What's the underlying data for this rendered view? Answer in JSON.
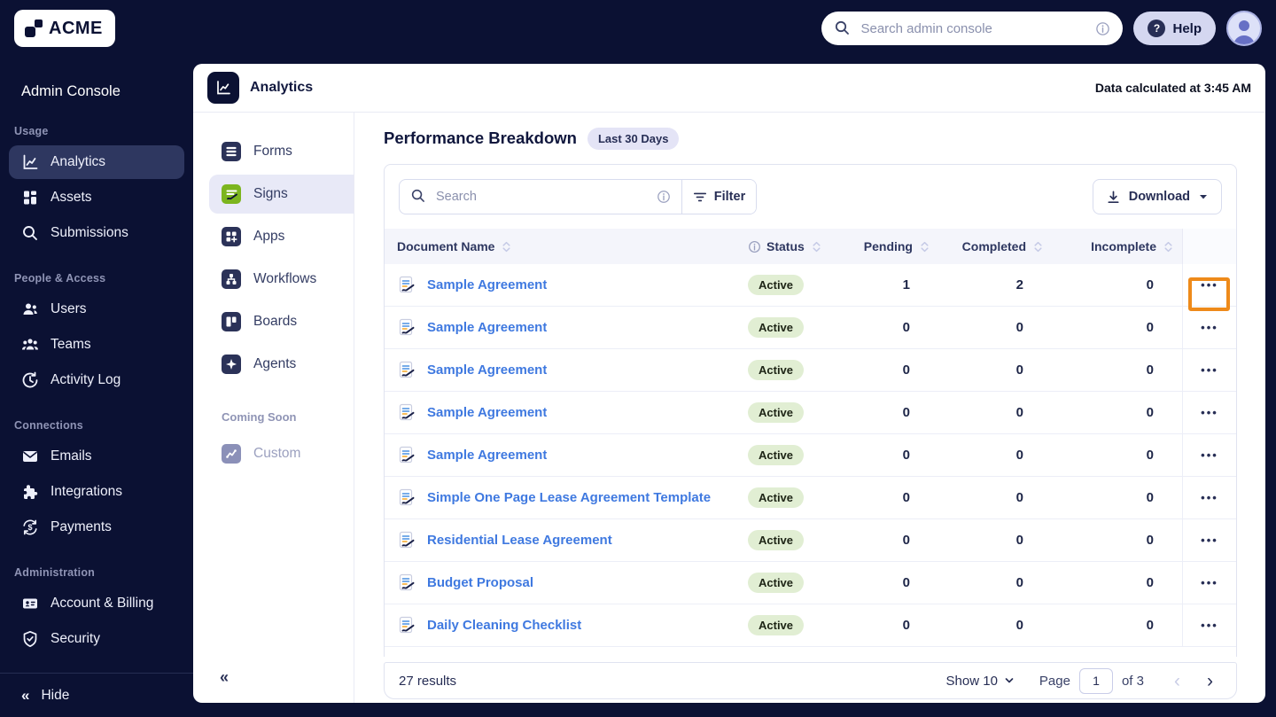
{
  "colors": {
    "navy_bg": "#0b1133",
    "sidebar_active_bg": "#2e3760",
    "panel_bg": "#ffffff",
    "table_header_bg": "#f4f5fb",
    "link_blue": "#3f79e0",
    "active_badge_bg": "#e1eed3",
    "sign_green": "#7cb51e",
    "highlight_orange": "#ee8a1a",
    "badge_lavender": "#e4e4f6"
  },
  "icons": {
    "collapse_glyph": "«",
    "dots_glyph": "•••",
    "prev_glyph": "‹",
    "next_glyph": "›",
    "help_glyph": "?"
  },
  "topbar": {
    "logo_text": "ACME",
    "search_placeholder": "Search admin console",
    "help_label": "Help"
  },
  "sidebar": {
    "title": "Admin Console",
    "sections": [
      {
        "label": "Usage",
        "items": [
          {
            "label": "Analytics",
            "active": true
          },
          {
            "label": "Assets"
          },
          {
            "label": "Submissions"
          }
        ]
      },
      {
        "label": "People & Access",
        "items": [
          {
            "label": "Users"
          },
          {
            "label": "Teams"
          },
          {
            "label": "Activity Log"
          }
        ]
      },
      {
        "label": "Connections",
        "items": [
          {
            "label": "Emails"
          },
          {
            "label": "Integrations"
          },
          {
            "label": "Payments"
          }
        ]
      },
      {
        "label": "Administration",
        "items": [
          {
            "label": "Account & Billing"
          },
          {
            "label": "Security"
          }
        ]
      }
    ],
    "hide_label": "Hide"
  },
  "subsidebar": {
    "items": [
      {
        "label": "Forms"
      },
      {
        "label": "Signs",
        "active": true
      },
      {
        "label": "Apps"
      },
      {
        "label": "Workflows"
      },
      {
        "label": "Boards"
      },
      {
        "label": "Agents"
      }
    ],
    "coming_soon_label": "Coming Soon",
    "coming_soon_item": "Custom"
  },
  "panel": {
    "title": "Analytics",
    "data_note": "Data calculated at 3:45 AM"
  },
  "content": {
    "heading": "Performance Breakdown",
    "badge": "Last 30 Days",
    "search_placeholder": "Search",
    "filter_label": "Filter",
    "download_label": "Download"
  },
  "table": {
    "columns": [
      "Document Name",
      "Status",
      "Pending",
      "Completed",
      "Incomplete"
    ],
    "rows": [
      {
        "name": "Sample Agreement",
        "status": "Active",
        "pending": 1,
        "completed": 2,
        "incomplete": 0,
        "highlighted": true
      },
      {
        "name": "Sample Agreement",
        "status": "Active",
        "pending": 0,
        "completed": 0,
        "incomplete": 0
      },
      {
        "name": "Sample Agreement",
        "status": "Active",
        "pending": 0,
        "completed": 0,
        "incomplete": 0
      },
      {
        "name": "Sample Agreement",
        "status": "Active",
        "pending": 0,
        "completed": 0,
        "incomplete": 0
      },
      {
        "name": "Sample Agreement",
        "status": "Active",
        "pending": 0,
        "completed": 0,
        "incomplete": 0
      },
      {
        "name": "Simple One Page Lease Agreement Template",
        "status": "Active",
        "pending": 0,
        "completed": 0,
        "incomplete": 0
      },
      {
        "name": "Residential Lease Agreement",
        "status": "Active",
        "pending": 0,
        "completed": 0,
        "incomplete": 0
      },
      {
        "name": "Budget Proposal",
        "status": "Active",
        "pending": 0,
        "completed": 0,
        "incomplete": 0
      },
      {
        "name": "Daily Cleaning Checklist",
        "status": "Active",
        "pending": 0,
        "completed": 0,
        "incomplete": 0
      }
    ]
  },
  "footer": {
    "results": "27 results",
    "show_label": "Show 10",
    "page_label": "Page",
    "page_value": "1",
    "of_label": "of 3"
  }
}
